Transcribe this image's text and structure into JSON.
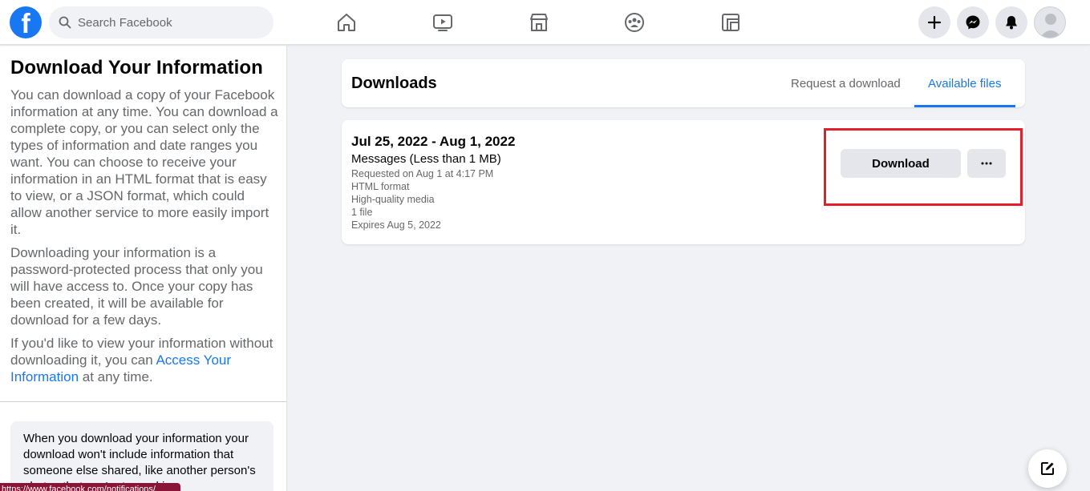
{
  "topbar": {
    "logo": "f",
    "search_placeholder": "Search Facebook",
    "nav_icons": [
      "home-icon",
      "watch-icon",
      "marketplace-icon",
      "groups-icon",
      "gaming-icon"
    ],
    "actions": [
      "create-icon",
      "messenger-icon",
      "notifications-icon",
      "avatar"
    ]
  },
  "left": {
    "title": "Download Your Information",
    "p1": "You can download a copy of your Facebook information at any time. You can download a complete copy, or you can select only the types of information and date ranges you want. You can choose to receive your information in an HTML format that is easy to view, or a JSON format, which could allow another service to more easily import it.",
    "p2": "Downloading your information is a password-protected process that only you will have access to. Once your copy has been created, it will be available for download for a few days.",
    "p3_before": "If you'd like to view your information without downloading it, you can ",
    "p3_link": "Access Your Information",
    "p3_after": " at any time.",
    "notice": "When you download your information your download won't include information that someone else shared, like another person's photos that you're tagged in.",
    "status_url": "https://www.facebook.com/notifications/"
  },
  "downloads": {
    "title": "Downloads",
    "tabs": [
      "Request a download",
      "Available files"
    ],
    "active_tab": "Available files"
  },
  "file": {
    "date_range": "Jul 25, 2022 - Aug 1, 2022",
    "type": "Messages (Less than 1 MB)",
    "requested": "Requested on Aug 1 at 4:17 PM",
    "format": "HTML format",
    "media": "High-quality media",
    "count": "1 file",
    "expires": "Expires Aug 5, 2022",
    "download_label": "Download",
    "more_label": "···"
  },
  "colors": {
    "brand": "#1877f2",
    "highlight": "#e41e2b"
  }
}
